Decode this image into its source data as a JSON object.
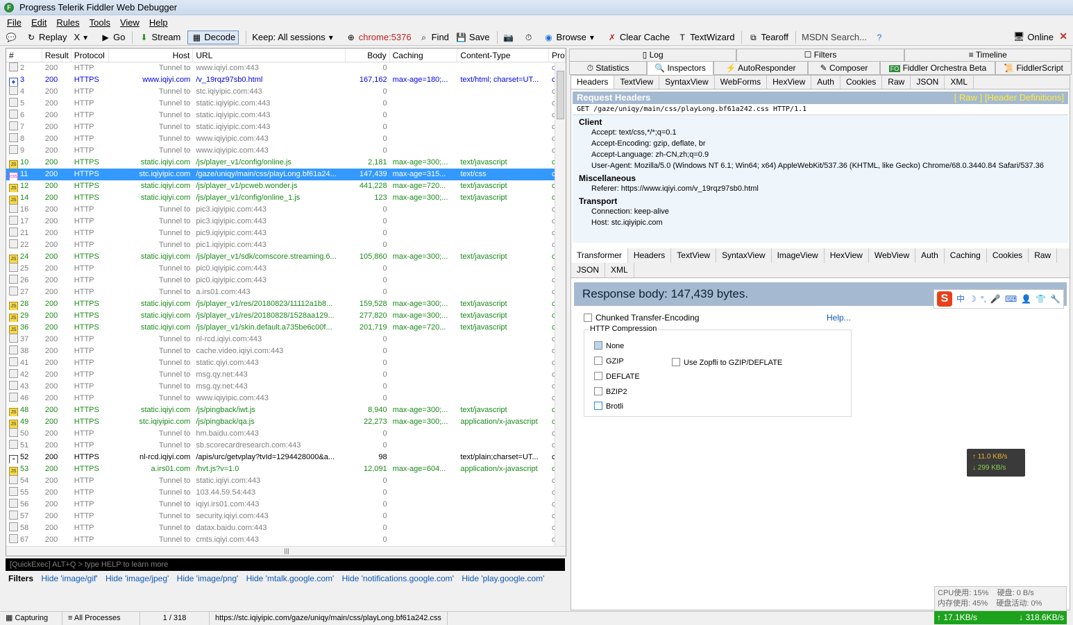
{
  "window": {
    "title": "Progress Telerik Fiddler Web Debugger"
  },
  "menu": [
    "File",
    "Edit",
    "Rules",
    "Tools",
    "View",
    "Help"
  ],
  "toolbar": {
    "replay": "Replay",
    "x": "X",
    "go": "Go",
    "stream": "Stream",
    "decode": "Decode",
    "keep": "Keep: All sessions",
    "process": "chrome:5376",
    "find": "Find",
    "save": "Save",
    "browse": "Browse",
    "clear_cache": "Clear Cache",
    "textwizard": "TextWizard",
    "tearoff": "Tearoff",
    "msdn": "MSDN Search...",
    "online": "Online"
  },
  "columns": [
    "#",
    "Result",
    "Protocol",
    "Host",
    "URL",
    "Body",
    "Caching",
    "Content-Type",
    "Pro"
  ],
  "sessions": [
    {
      "n": "2",
      "r": "200",
      "p": "HTTP",
      "h": "Tunnel to",
      "u": "www.iqiyi.com:443",
      "b": "0",
      "c": "",
      "t": "",
      "pr": "chr",
      "k": "tunnel",
      "i": "lock"
    },
    {
      "n": "3",
      "r": "200",
      "p": "HTTPS",
      "h": "www.iqiyi.com",
      "u": "/v_19rqz97sb0.html",
      "b": "167,162",
      "c": "max-age=180;...",
      "t": "text/html; charset=UT...",
      "pr": "chr",
      "k": "html",
      "i": "html"
    },
    {
      "n": "4",
      "r": "200",
      "p": "HTTP",
      "h": "Tunnel to",
      "u": "stc.iqiyipic.com:443",
      "b": "0",
      "c": "",
      "t": "",
      "pr": "chr",
      "k": "tunnel",
      "i": "lock"
    },
    {
      "n": "5",
      "r": "200",
      "p": "HTTP",
      "h": "Tunnel to",
      "u": "static.iqiyipic.com:443",
      "b": "0",
      "c": "",
      "t": "",
      "pr": "chr",
      "k": "tunnel",
      "i": "lock"
    },
    {
      "n": "6",
      "r": "200",
      "p": "HTTP",
      "h": "Tunnel to",
      "u": "static.iqiyipic.com:443",
      "b": "0",
      "c": "",
      "t": "",
      "pr": "chr",
      "k": "tunnel",
      "i": "lock"
    },
    {
      "n": "7",
      "r": "200",
      "p": "HTTP",
      "h": "Tunnel to",
      "u": "static.iqiyipic.com:443",
      "b": "0",
      "c": "",
      "t": "",
      "pr": "chr",
      "k": "tunnel",
      "i": "lock"
    },
    {
      "n": "8",
      "r": "200",
      "p": "HTTP",
      "h": "Tunnel to",
      "u": "www.iqiyipic.com:443",
      "b": "0",
      "c": "",
      "t": "",
      "pr": "chr",
      "k": "tunnel",
      "i": "lock"
    },
    {
      "n": "9",
      "r": "200",
      "p": "HTTP",
      "h": "Tunnel to",
      "u": "www.iqiyipic.com:443",
      "b": "0",
      "c": "",
      "t": "",
      "pr": "chr",
      "k": "tunnel",
      "i": "lock"
    },
    {
      "n": "10",
      "r": "200",
      "p": "HTTPS",
      "h": "static.iqiyi.com",
      "u": "/js/player_v1/config/online.js",
      "b": "2,181",
      "c": "max-age=300;...",
      "t": "text/javascript",
      "pr": "chr",
      "k": "js",
      "i": "js"
    },
    {
      "n": "11",
      "r": "200",
      "p": "HTTPS",
      "h": "stc.iqiyipic.com",
      "u": "/gaze/uniqy/main/css/playLong.bf61a24...",
      "b": "147,439",
      "c": "max-age=315...",
      "t": "text/css",
      "pr": "chr",
      "k": "sel",
      "i": "css"
    },
    {
      "n": "12",
      "r": "200",
      "p": "HTTPS",
      "h": "static.iqiyi.com",
      "u": "/js/player_v1/pcweb.wonder.js",
      "b": "441,228",
      "c": "max-age=720...",
      "t": "text/javascript",
      "pr": "chr",
      "k": "js",
      "i": "js"
    },
    {
      "n": "14",
      "r": "200",
      "p": "HTTPS",
      "h": "static.iqiyi.com",
      "u": "/js/player_v1/config/online_1.js",
      "b": "123",
      "c": "max-age=300;...",
      "t": "text/javascript",
      "pr": "chr",
      "k": "js",
      "i": "js"
    },
    {
      "n": "16",
      "r": "200",
      "p": "HTTP",
      "h": "Tunnel to",
      "u": "pic3.iqiyipic.com:443",
      "b": "0",
      "c": "",
      "t": "",
      "pr": "chr",
      "k": "tunnel",
      "i": "lock"
    },
    {
      "n": "17",
      "r": "200",
      "p": "HTTP",
      "h": "Tunnel to",
      "u": "pic3.iqiyipic.com:443",
      "b": "0",
      "c": "",
      "t": "",
      "pr": "chr",
      "k": "tunnel",
      "i": "lock"
    },
    {
      "n": "21",
      "r": "200",
      "p": "HTTP",
      "h": "Tunnel to",
      "u": "pic9.iqiyipic.com:443",
      "b": "0",
      "c": "",
      "t": "",
      "pr": "chr",
      "k": "tunnel",
      "i": "lock"
    },
    {
      "n": "22",
      "r": "200",
      "p": "HTTP",
      "h": "Tunnel to",
      "u": "pic1.iqiyipic.com:443",
      "b": "0",
      "c": "",
      "t": "",
      "pr": "chr",
      "k": "tunnel",
      "i": "lock"
    },
    {
      "n": "24",
      "r": "200",
      "p": "HTTPS",
      "h": "static.iqiyi.com",
      "u": "/js/player_v1/sdk/comscore.streaming.6...",
      "b": "105,860",
      "c": "max-age=300;...",
      "t": "text/javascript",
      "pr": "chr",
      "k": "js",
      "i": "js"
    },
    {
      "n": "25",
      "r": "200",
      "p": "HTTP",
      "h": "Tunnel to",
      "u": "pic0.iqiyipic.com:443",
      "b": "0",
      "c": "",
      "t": "",
      "pr": "chr",
      "k": "tunnel",
      "i": "lock"
    },
    {
      "n": "26",
      "r": "200",
      "p": "HTTP",
      "h": "Tunnel to",
      "u": "pic0.iqiyipic.com:443",
      "b": "0",
      "c": "",
      "t": "",
      "pr": "chr",
      "k": "tunnel",
      "i": "lock"
    },
    {
      "n": "27",
      "r": "200",
      "p": "HTTP",
      "h": "Tunnel to",
      "u": "a.irs01.com:443",
      "b": "0",
      "c": "",
      "t": "",
      "pr": "chr",
      "k": "tunnel",
      "i": "lock"
    },
    {
      "n": "28",
      "r": "200",
      "p": "HTTPS",
      "h": "static.iqiyi.com",
      "u": "/js/player_v1/res/20180823/11112a1b8...",
      "b": "159,528",
      "c": "max-age=300;...",
      "t": "text/javascript",
      "pr": "chr",
      "k": "js",
      "i": "js"
    },
    {
      "n": "29",
      "r": "200",
      "p": "HTTPS",
      "h": "static.iqiyi.com",
      "u": "/js/player_v1/res/20180828/1528aa129...",
      "b": "277,820",
      "c": "max-age=300;...",
      "t": "text/javascript",
      "pr": "chr",
      "k": "js",
      "i": "js"
    },
    {
      "n": "36",
      "r": "200",
      "p": "HTTPS",
      "h": "static.iqiyi.com",
      "u": "/js/player_v1/skin.default.a735be6c00f...",
      "b": "201,719",
      "c": "max-age=720...",
      "t": "text/javascript",
      "pr": "chr",
      "k": "js",
      "i": "js"
    },
    {
      "n": "37",
      "r": "200",
      "p": "HTTP",
      "h": "Tunnel to",
      "u": "nl-rcd.iqiyi.com:443",
      "b": "0",
      "c": "",
      "t": "",
      "pr": "chr",
      "k": "tunnel",
      "i": "lock"
    },
    {
      "n": "38",
      "r": "200",
      "p": "HTTP",
      "h": "Tunnel to",
      "u": "cache.video.iqiyi.com:443",
      "b": "0",
      "c": "",
      "t": "",
      "pr": "chr",
      "k": "tunnel",
      "i": "lock"
    },
    {
      "n": "41",
      "r": "200",
      "p": "HTTP",
      "h": "Tunnel to",
      "u": "static.qiyi.com:443",
      "b": "0",
      "c": "",
      "t": "",
      "pr": "chr",
      "k": "tunnel",
      "i": "lock"
    },
    {
      "n": "42",
      "r": "200",
      "p": "HTTP",
      "h": "Tunnel to",
      "u": "msg.qy.net:443",
      "b": "0",
      "c": "",
      "t": "",
      "pr": "chr",
      "k": "tunnel",
      "i": "lock"
    },
    {
      "n": "43",
      "r": "200",
      "p": "HTTP",
      "h": "Tunnel to",
      "u": "msg.qy.net:443",
      "b": "0",
      "c": "",
      "t": "",
      "pr": "chr",
      "k": "tunnel",
      "i": "lock"
    },
    {
      "n": "46",
      "r": "200",
      "p": "HTTP",
      "h": "Tunnel to",
      "u": "www.iqiyipic.com:443",
      "b": "0",
      "c": "",
      "t": "",
      "pr": "chr",
      "k": "tunnel",
      "i": "lock"
    },
    {
      "n": "48",
      "r": "200",
      "p": "HTTPS",
      "h": "static.iqiyi.com",
      "u": "/js/pingback/iwt.js",
      "b": "8,940",
      "c": "max-age=300;...",
      "t": "text/javascript",
      "pr": "chr",
      "k": "js",
      "i": "js"
    },
    {
      "n": "49",
      "r": "200",
      "p": "HTTPS",
      "h": "stc.iqiyipic.com",
      "u": "/js/pingback/qa.js",
      "b": "22,273",
      "c": "max-age=300;...",
      "t": "application/x-javascript",
      "pr": "chr",
      "k": "js",
      "i": "js"
    },
    {
      "n": "50",
      "r": "200",
      "p": "HTTP",
      "h": "Tunnel to",
      "u": "hm.baidu.com:443",
      "b": "0",
      "c": "",
      "t": "",
      "pr": "chr",
      "k": "tunnel",
      "i": "lock"
    },
    {
      "n": "51",
      "r": "200",
      "p": "HTTP",
      "h": "Tunnel to",
      "u": "sb.scorecardresearch.com:443",
      "b": "0",
      "c": "",
      "t": "",
      "pr": "chr",
      "k": "tunnel",
      "i": "lock"
    },
    {
      "n": "52",
      "r": "200",
      "p": "HTTPS",
      "h": "nl-rcd.iqiyi.com",
      "u": "/apis/urc/getvplay?tvId=1294428000&a...",
      "b": "98",
      "c": "",
      "t": "text/plain;charset=UT...",
      "pr": "chr",
      "k": "black",
      "i": "txt"
    },
    {
      "n": "53",
      "r": "200",
      "p": "HTTPS",
      "h": "a.irs01.com",
      "u": "/hvt.js?v=1.0",
      "b": "12,091",
      "c": "max-age=604...",
      "t": "application/x-javascript",
      "pr": "chr",
      "k": "js",
      "i": "js"
    },
    {
      "n": "54",
      "r": "200",
      "p": "HTTP",
      "h": "Tunnel to",
      "u": "static.iqiyi.com:443",
      "b": "0",
      "c": "",
      "t": "",
      "pr": "chr",
      "k": "tunnel",
      "i": "lock"
    },
    {
      "n": "55",
      "r": "200",
      "p": "HTTP",
      "h": "Tunnel to",
      "u": "103.44.59.54:443",
      "b": "0",
      "c": "",
      "t": "",
      "pr": "chr",
      "k": "tunnel",
      "i": "lock"
    },
    {
      "n": "56",
      "r": "200",
      "p": "HTTP",
      "h": "Tunnel to",
      "u": "iqiyi.irs01.com:443",
      "b": "0",
      "c": "",
      "t": "",
      "pr": "chr",
      "k": "tunnel",
      "i": "lock"
    },
    {
      "n": "57",
      "r": "200",
      "p": "HTTP",
      "h": "Tunnel to",
      "u": "security.iqiyi.com:443",
      "b": "0",
      "c": "",
      "t": "",
      "pr": "chr",
      "k": "tunnel",
      "i": "lock"
    },
    {
      "n": "58",
      "r": "200",
      "p": "HTTP",
      "h": "Tunnel to",
      "u": "datax.baidu.com:443",
      "b": "0",
      "c": "",
      "t": "",
      "pr": "chr",
      "k": "tunnel",
      "i": "lock"
    },
    {
      "n": "67",
      "r": "200",
      "p": "HTTP",
      "h": "Tunnel to",
      "u": "cmts.iqiyi.com:443",
      "b": "0",
      "c": "",
      "t": "",
      "pr": "chr",
      "k": "tunnel",
      "i": "lock"
    }
  ],
  "quickexec": "[QuickExec] ALT+Q > type HELP to learn more",
  "filters": {
    "label": "Filters",
    "items": [
      "Hide 'image/gif'",
      "Hide 'image/jpeg'",
      "Hide 'image/png'",
      "Hide 'mtalk.google.com'",
      "Hide 'notifications.google.com'",
      "Hide 'play.google.com'"
    ]
  },
  "right_tabs_top": [
    "Log",
    "Filters",
    "Timeline"
  ],
  "right_tabs": [
    "Statistics",
    "Inspectors",
    "AutoResponder",
    "Composer",
    "Fiddler Orchestra Beta",
    "FiddlerScript"
  ],
  "fo_badge": "FO",
  "req_tabs": [
    "Headers",
    "TextView",
    "SyntaxView",
    "WebForms",
    "HexView",
    "Auth",
    "Cookies",
    "Raw",
    "JSON",
    "XML"
  ],
  "request": {
    "title": "Request Headers",
    "links": "[ Raw ]   [Header Definitions]",
    "line": "GET /gaze/uniqy/main/css/playLong.bf61a242.css HTTP/1.1",
    "groups": [
      {
        "name": "Client",
        "items": [
          "Accept: text/css,*/*;q=0.1",
          "Accept-Encoding: gzip, deflate, br",
          "Accept-Language: zh-CN,zh;q=0.9",
          "User-Agent: Mozilla/5.0 (Windows NT 6.1; Win64; x64) AppleWebKit/537.36 (KHTML, like Gecko) Chrome/68.0.3440.84 Safari/537.36"
        ]
      },
      {
        "name": "Miscellaneous",
        "items": [
          "Referer: https://www.iqiyi.com/v_19rqz97sb0.html"
        ]
      },
      {
        "name": "Transport",
        "items": [
          "Connection: keep-alive",
          "Host: stc.iqiyipic.com"
        ]
      }
    ]
  },
  "resp_tabs": [
    "Transformer",
    "Headers",
    "TextView",
    "SyntaxView",
    "ImageView",
    "HexView",
    "WebView",
    "Auth",
    "Caching",
    "Cookies",
    "Raw",
    "JSON",
    "XML"
  ],
  "response": {
    "body_size": "Response body: 147,439 bytes.",
    "chunked": "Chunked Transfer-Encoding",
    "help": "Help...",
    "compression_label": "HTTP Compression",
    "options": [
      "None",
      "GZIP",
      "DEFLATE",
      "BZIP2",
      "Brotli"
    ],
    "zopfli": "Use Zopfli to GZIP/DEFLATE"
  },
  "ime": {
    "s": "S",
    "items": [
      "中",
      "☽",
      "°,",
      "🎤",
      "⌨",
      "👤",
      "👕",
      "🔧"
    ]
  },
  "speed": {
    "up": "↑  11.0 KB/s",
    "down": "↓  299 KB/s"
  },
  "sys": {
    "cpu": "CPU使用: 15%",
    "disk": "硬盘: 0 B/s",
    "mem": "内存使用: 45%",
    "disk_act": "硬盘活动: 0%"
  },
  "net": {
    "up": "↑  17.1KB/s",
    "down": "↓ 318.6KB/s"
  },
  "status": {
    "capturing": "Capturing",
    "processes": "All Processes",
    "count": "1 / 318",
    "url": "https://stc.iqiyipic.com/gaze/uniqy/main/css/playLong.bf61a242.css"
  }
}
